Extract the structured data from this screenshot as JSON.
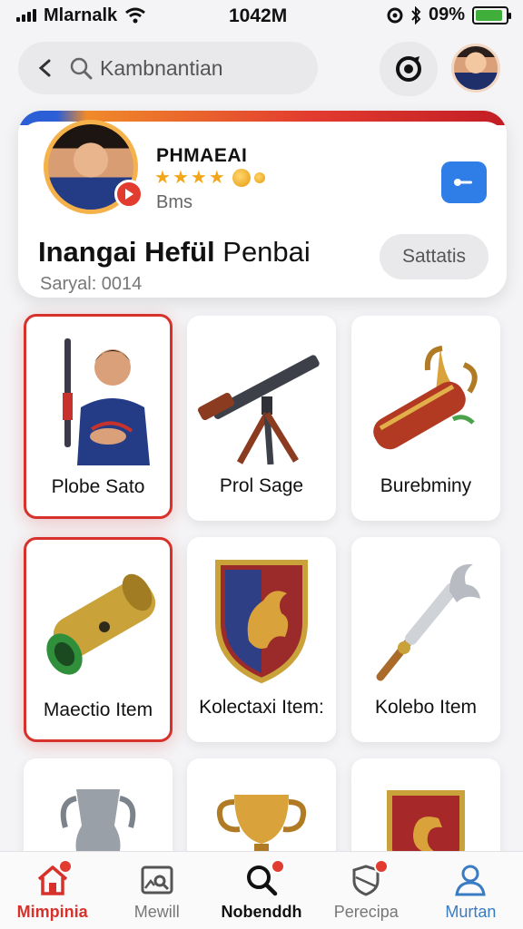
{
  "status_bar": {
    "carrier": "Mlarnalk",
    "time": "1042M",
    "battery_percent": "09%",
    "battery_level": 0.9
  },
  "search": {
    "placeholder": "Kambnantian"
  },
  "profile": {
    "name": "PHMAEAI",
    "rating_stars": 4,
    "subtitle": "Bms",
    "title_bold": "Inangai Hefül",
    "title_rest": "Penbai",
    "meta": "Saryal: 0014",
    "status_button": "Sattatis"
  },
  "grid": {
    "items": [
      {
        "label": "Plobe Sato",
        "icon": "player-with-baton"
      },
      {
        "label": "Prol Sage",
        "icon": "rifle-on-tripod"
      },
      {
        "label": "Burebminy",
        "icon": "trophy-scroll"
      },
      {
        "label": "Maectio Item",
        "icon": "cannon-barrel"
      },
      {
        "label": "Kolectaxi Item:",
        "icon": "dragon-shield"
      },
      {
        "label": "Kolebo Item",
        "icon": "ornate-staff"
      },
      {
        "label": "",
        "icon": "silver-vase"
      },
      {
        "label": "",
        "icon": "gold-trophy"
      },
      {
        "label": "",
        "icon": "red-shield"
      }
    ]
  },
  "nav": {
    "items": [
      {
        "label": "Mimpinia",
        "icon": "home-icon"
      },
      {
        "label": "Mewill",
        "icon": "photo-search-icon"
      },
      {
        "label": "Nobenddh",
        "icon": "search-icon"
      },
      {
        "label": "Perecipa",
        "icon": "shield-icon"
      },
      {
        "label": "Murtan",
        "icon": "user-icon"
      }
    ]
  },
  "colors": {
    "accent_red": "#d6312b",
    "accent_blue": "#2f7de6",
    "star_gold": "#f2a71b"
  }
}
